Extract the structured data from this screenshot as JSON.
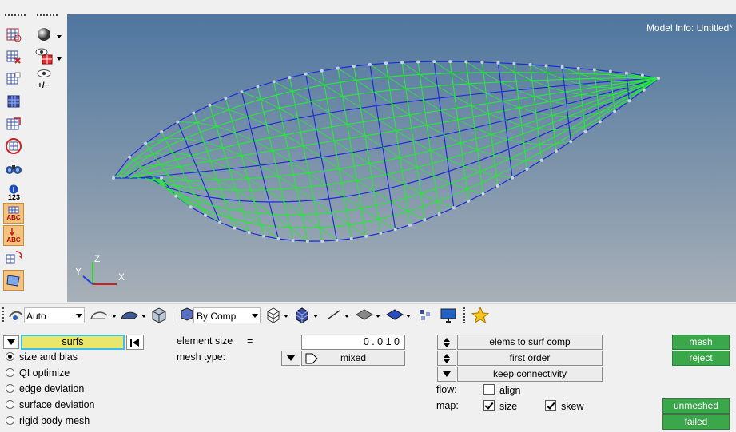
{
  "viewport": {
    "model_info": "Model Info: Untitled*",
    "axis": {
      "x": "X",
      "y": "Y",
      "z": "Z"
    },
    "mesh_color": "#29e63a",
    "edge_color": "#1c2fd6"
  },
  "left_toolbar": {
    "icons": [
      "mask-icon",
      "shaded-sphere-icon",
      "mask-element-icon",
      "visibility-icon",
      "mask-adjacent-icon",
      "show-hide-icon",
      "reverse-mask-icon",
      "unmask-all-icon",
      "find-icon",
      "binoculars-icon",
      "numbers-icon",
      "label-abc-icon",
      "label-abc-down-icon",
      "transform-icon",
      "bounding-box-icon"
    ],
    "numbers_label": "123",
    "abc_label": "ABC",
    "plus_minus": "+/−"
  },
  "bottom_toolbar": {
    "display_mode": "Auto",
    "color_mode": "By Comp"
  },
  "panel": {
    "selector_label": "surfs",
    "modes": [
      {
        "label": "size and bias",
        "selected": true
      },
      {
        "label": "QI optimize",
        "selected": false
      },
      {
        "label": "edge deviation",
        "selected": false
      },
      {
        "label": "surface deviation",
        "selected": false
      },
      {
        "label": "rigid body mesh",
        "selected": false
      }
    ],
    "element_size_label": "element size",
    "equals": "=",
    "element_size_value": "0 . 0 1 0",
    "mesh_type_label": "mesh type:",
    "mesh_type_value": "mixed",
    "elems_to_surf_comp": "elems to surf comp",
    "first_order": "first order",
    "keep_connectivity": "keep connectivity",
    "flow_label": "flow:",
    "align_label": "align",
    "map_label": "map:",
    "size_label": "size",
    "skew_label": "skew",
    "mesh_button": "mesh",
    "reject_button": "reject",
    "unmeshed_button": "unmeshed",
    "failed_button": "failed",
    "status_colors": {
      "green": "#3aa74a",
      "highlight": "#e9e66b"
    }
  }
}
